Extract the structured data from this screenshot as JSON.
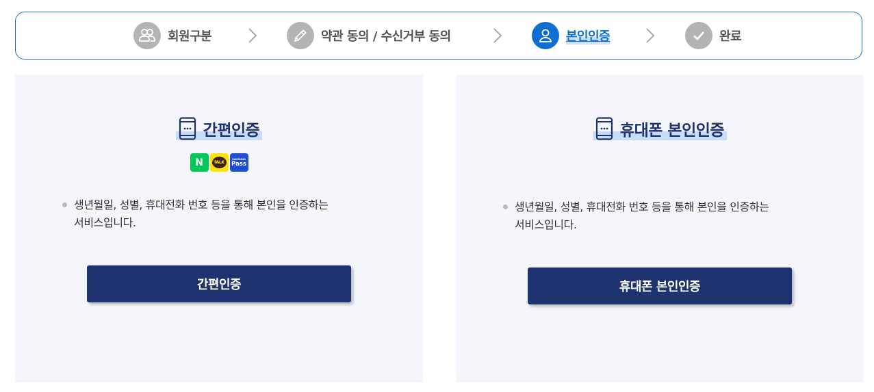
{
  "steps": [
    {
      "label": "회원구분",
      "icon": "users-icon",
      "state": "done"
    },
    {
      "label": "약관 동의 / 수신거부 동의",
      "icon": "pencil-icon",
      "state": "done"
    },
    {
      "label": "본인인증",
      "icon": "user-icon",
      "state": "active"
    },
    {
      "label": "완료",
      "icon": "check-icon",
      "state": "pending"
    }
  ],
  "colors": {
    "accent": "#0f6fd0",
    "navy": "#1e3270",
    "panel_bg": "#f4f6fb",
    "inactive_step": "#b4b4b4"
  },
  "panels": [
    {
      "title": "간편인증",
      "icon": "smartphone-icon",
      "logos": [
        {
          "name": "naver-logo",
          "text": "N"
        },
        {
          "name": "kakao-logo",
          "text": "TALK"
        },
        {
          "name": "samsung-pass-logo",
          "small": "SAMSUNG",
          "text": "Pass"
        }
      ],
      "desc_line1": "생년월일, 성별, 휴대전화 번호 등을 통해 본인을 인증하는",
      "desc_line2": "서비스입니다.",
      "button": "간편인증"
    },
    {
      "title": "휴대폰 본인인증",
      "icon": "smartphone-icon",
      "desc_line1": "생년월일, 성별, 휴대전화 번호 등을 통해 본인을 인증하는",
      "desc_line2": "서비스입니다.",
      "button": "휴대폰 본인인증"
    }
  ]
}
